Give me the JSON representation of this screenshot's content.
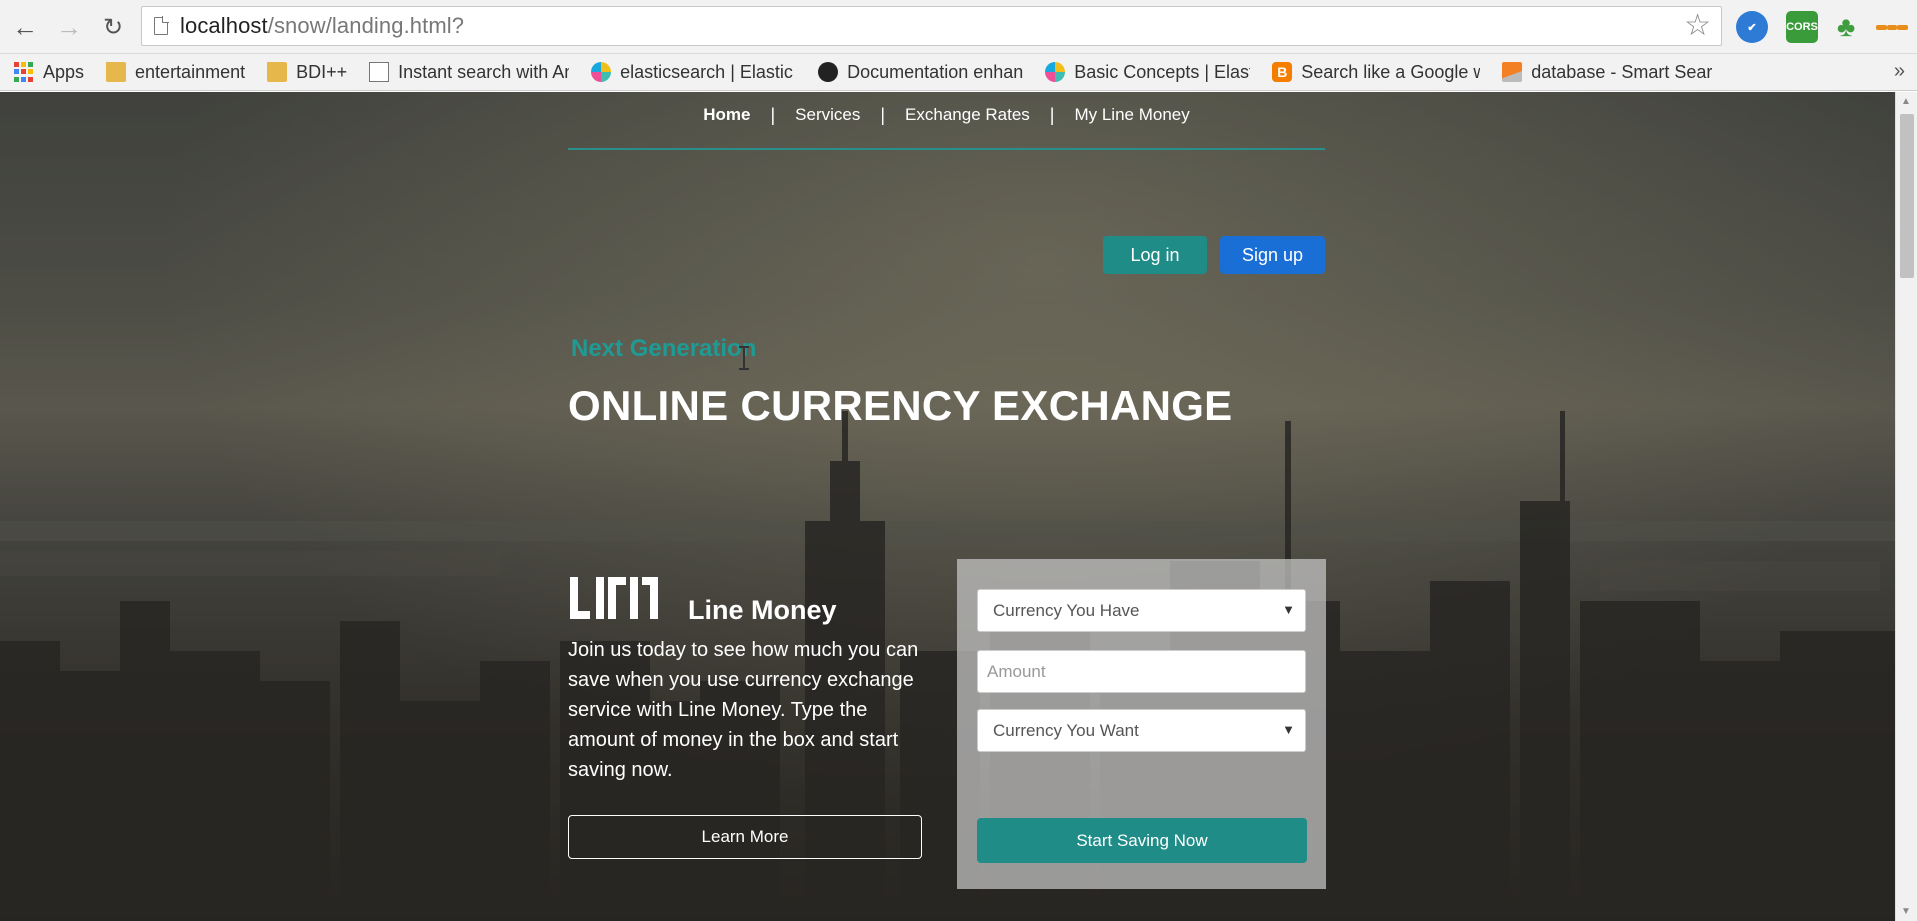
{
  "browser": {
    "url_host": "localhost",
    "url_path": "/snow/landing.html?",
    "extensions": [
      {
        "name": "chrome-ext-icon"
      },
      {
        "name": "cors-icon",
        "label": "CORS"
      },
      {
        "name": "tree-icon"
      },
      {
        "name": "menu-icon"
      }
    ]
  },
  "bookmarks": [
    {
      "label": "Apps",
      "icon": "apps-grid-icon"
    },
    {
      "label": "entertainment",
      "icon": "folder-icon"
    },
    {
      "label": "BDI++",
      "icon": "folder-icon"
    },
    {
      "label": "Instant search with An",
      "icon": "page-icon"
    },
    {
      "label": "elasticsearch | Elastic I",
      "icon": "elastic-icon"
    },
    {
      "label": "Documentation enhan",
      "icon": "github-icon"
    },
    {
      "label": "Basic Concepts | Elasti",
      "icon": "elastic-icon"
    },
    {
      "label": "Search like a Google w",
      "icon": "blogger-icon"
    },
    {
      "label": "database - Smart Sear",
      "icon": "stackoverflow-icon"
    }
  ],
  "nav": {
    "items": [
      "Home",
      "Services",
      "Exchange Rates",
      "My Line Money"
    ],
    "active": "Home"
  },
  "auth": {
    "login": "Log in",
    "signup": "Sign up"
  },
  "hero": {
    "kicker": "Next Generation",
    "headline": "ONLINE CURRENCY EXCHANGE"
  },
  "brand": {
    "name": "Line Money",
    "blurb": "Join us today to see how much you can save when you use currency exchange service with Line Money. Type the amount of money in the box and start saving now.",
    "learn_more": "Learn More"
  },
  "form": {
    "currency_have": "Currency You Have",
    "amount_placeholder": "Amount",
    "currency_want": "Currency You Want",
    "submit": "Start Saving Now"
  },
  "colors": {
    "teal": "#1f8c87",
    "blue": "#1a6fd6"
  }
}
